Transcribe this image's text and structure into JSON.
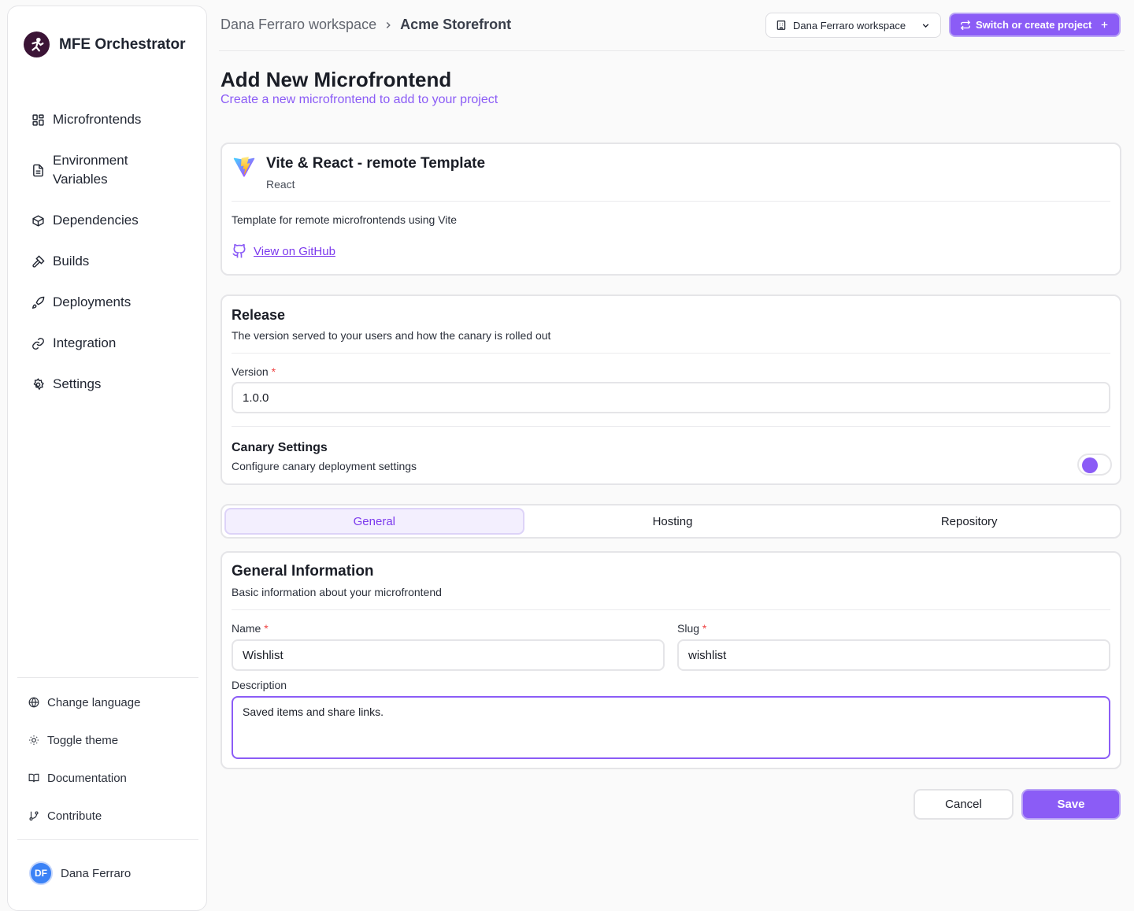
{
  "brand": {
    "name": "MFE Orchestrator",
    "icon": "fighter-logo-icon"
  },
  "sidebar": {
    "items": [
      {
        "label": "Microfrontends",
        "icon": "grid-icon"
      },
      {
        "label": "Environment Variables",
        "icon": "file-text-icon"
      },
      {
        "label": "Dependencies",
        "icon": "package-icon"
      },
      {
        "label": "Builds",
        "icon": "hammer-icon"
      },
      {
        "label": "Deployments",
        "icon": "rocket-icon"
      },
      {
        "label": "Integration",
        "icon": "link-icon"
      },
      {
        "label": "Settings",
        "icon": "gear-icon"
      }
    ],
    "utilities": [
      {
        "label": "Change language",
        "icon": "globe-icon"
      },
      {
        "label": "Toggle theme",
        "icon": "sun-icon"
      },
      {
        "label": "Documentation",
        "icon": "book-icon"
      },
      {
        "label": "Contribute",
        "icon": "git-branch-icon"
      }
    ],
    "user": {
      "initials": "DF",
      "name": "Dana Ferraro"
    }
  },
  "header": {
    "breadcrumb": [
      "Dana Ferraro workspace",
      "Acme Storefront"
    ],
    "workspace_select": "Dana Ferraro workspace",
    "switch_button": "Switch or create project"
  },
  "page": {
    "title": "Add New Microfrontend",
    "subtitle": "Create a new microfrontend to add to your project"
  },
  "template": {
    "title": "Vite & React - remote Template",
    "framework": "React",
    "description": "Template for remote microfrontends using Vite",
    "link": "View on GitHub"
  },
  "release": {
    "title": "Release",
    "subtitle": "The version served to your users and how the canary is rolled out",
    "version_label": "Version",
    "version_value": "1.0.0",
    "canary_title": "Canary Settings",
    "canary_subtitle": "Configure canary deployment settings",
    "canary_enabled": false
  },
  "tabs": [
    {
      "label": "General",
      "active": true
    },
    {
      "label": "Hosting",
      "active": false
    },
    {
      "label": "Repository",
      "active": false
    }
  ],
  "general": {
    "title": "General Information",
    "subtitle": "Basic information about your microfrontend",
    "name_label": "Name",
    "name_value": "Wishlist",
    "slug_label": "Slug",
    "slug_value": "wishlist",
    "description_label": "Description",
    "description_value": "Saved items and share links."
  },
  "actions": {
    "cancel": "Cancel",
    "save": "Save"
  },
  "colors": {
    "accent": "#8b5cf6",
    "required": "#ef4444",
    "avatar": "#3b82f6"
  }
}
